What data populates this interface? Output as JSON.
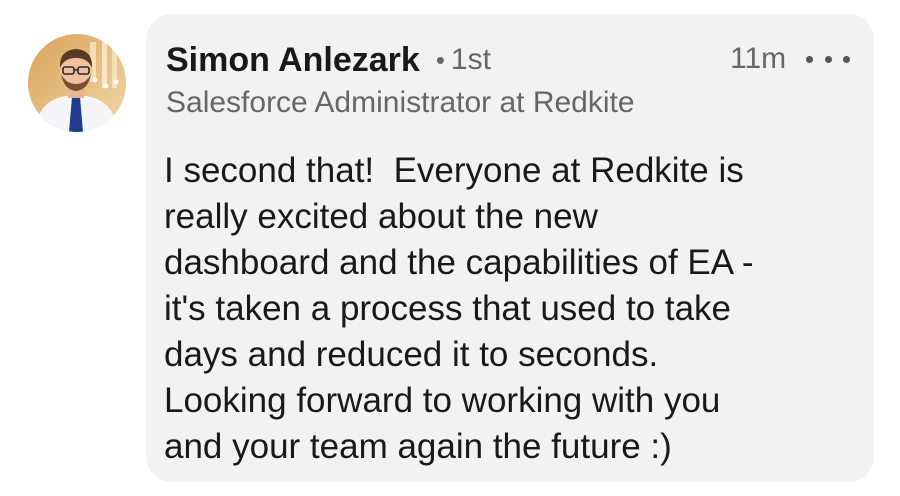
{
  "comment": {
    "author": {
      "name": "Simon Anlezark",
      "connection_separator": "•",
      "connection_degree": "1st",
      "headline": "Salesforce Administrator at Redkite",
      "avatar_icon": "profile-photo"
    },
    "timestamp": "11m",
    "more_icon": "more-horizontal-icon",
    "body_lines": [
      "I second that!  Everyone at Redkite is",
      "really excited about the new",
      "dashboard and the capabilities of EA -",
      "it's taken a process that used to take",
      "days and reduced it to seconds.",
      "Looking forward to working with you",
      "and your team again the future :)"
    ]
  },
  "colors": {
    "bubble_background": "#f2f2f3",
    "primary_text": "#191919",
    "secondary_text": "#666666"
  }
}
